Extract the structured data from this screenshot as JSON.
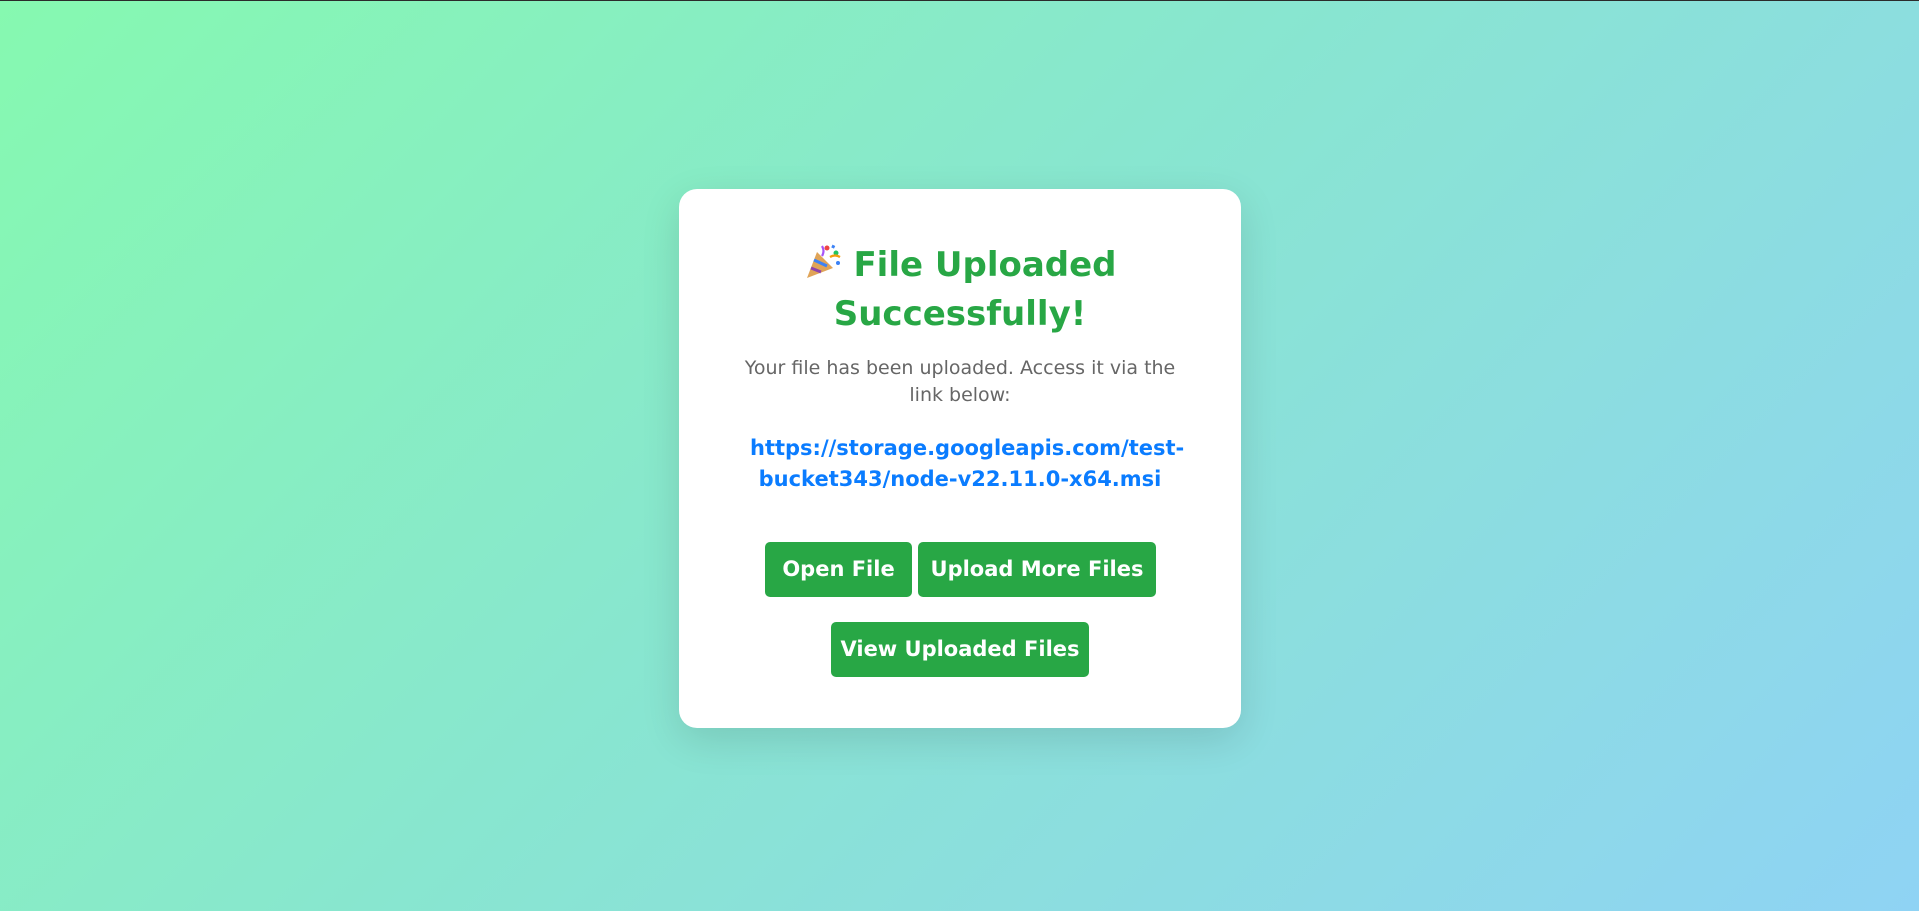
{
  "card": {
    "title": "File Uploaded Successfully!",
    "title_icon": "party-popper-icon",
    "message": "Your file has been uploaded. Access it via the link below:",
    "file_url": "https://storage.googleapis.com/test-bucket343/node-v22.11.0-x64.msi"
  },
  "actions": {
    "open_file": "Open File",
    "upload_more": "Upload More Files",
    "view_uploaded": "View Uploaded Files"
  },
  "colors": {
    "accent_green": "#28a745",
    "link_blue": "#0a7cff",
    "muted_text": "#666666",
    "background_start": "#86f9b0",
    "background_end": "#8fd3f4"
  }
}
